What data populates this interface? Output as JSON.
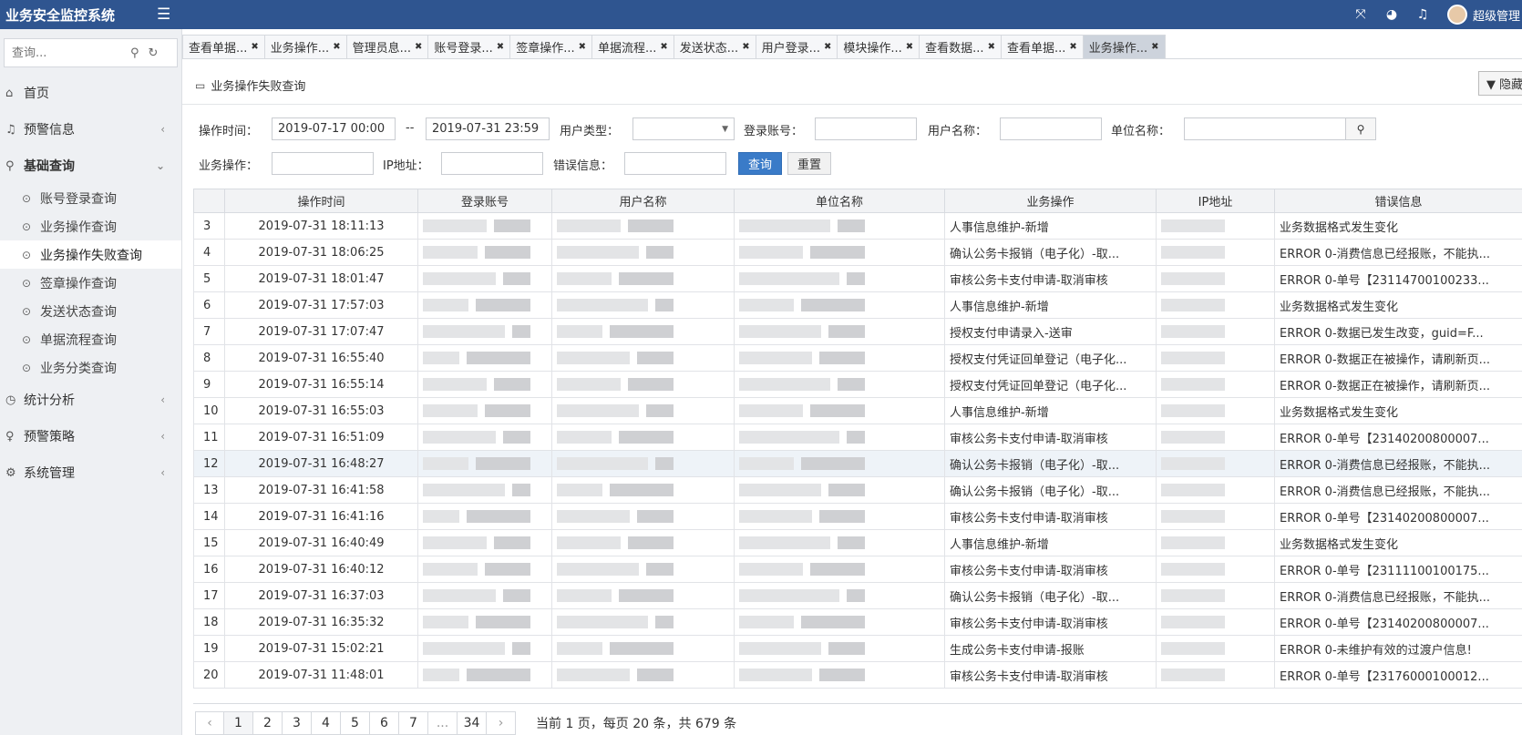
{
  "header": {
    "title": "业务安全监控系统",
    "user_name": "超级管理",
    "menu_icon": "hamburger-icon",
    "right_icons": [
      "fullscreen-icon",
      "dashboard-icon",
      "bell-icon"
    ]
  },
  "sidebar": {
    "search_placeholder": "查询...",
    "menu": [
      {
        "label": "首页",
        "icon": "home-icon"
      },
      {
        "label": "预警信息",
        "icon": "bell-icon"
      },
      {
        "label": "基础查询",
        "icon": "search-icon"
      },
      {
        "label": "统计分析",
        "icon": "clock-icon"
      },
      {
        "label": "预警策略",
        "icon": "bulb-icon"
      },
      {
        "label": "系统管理",
        "icon": "gear-icon"
      }
    ],
    "submenu": [
      "账号登录查询",
      "业务操作查询",
      "业务操作失败查询",
      "签章操作查询",
      "发送状态查询",
      "单据流程查询",
      "业务分类查询"
    ]
  },
  "tabs": [
    "查看单据...",
    "业务操作...",
    "管理员息...",
    "账号登录...",
    "签章操作...",
    "单据流程...",
    "发送状态...",
    "用户登录...",
    "模块操作...",
    "查看数据...",
    "查看单据...",
    "业务操作..."
  ],
  "page": {
    "title": "业务操作失败查询",
    "hide_label": "▼ 隐藏"
  },
  "filters": {
    "op_time_label": "操作时间：",
    "start_time": "2019-07-17 00:00",
    "range_sep": "--",
    "end_time": "2019-07-31 23:59",
    "user_type_label": "用户类型：",
    "login_account_label": "登录账号：",
    "user_name_label": "用户名称：",
    "unit_name_label": "单位名称：",
    "biz_op_label": "业务操作：",
    "ip_label": "IP地址：",
    "error_label": "错误信息：",
    "query_button": "查询",
    "reset_button": "重置"
  },
  "table": {
    "columns": [
      "",
      "操作时间",
      "登录账号",
      "用户名称",
      "单位名称",
      "业务操作",
      "IP地址",
      "错误信息"
    ],
    "rows": [
      {
        "idx": "3",
        "time": "2019-07-31 18:11:13",
        "op": "人事信息维护-新增",
        "error": "业务数据格式发生变化"
      },
      {
        "idx": "4",
        "time": "2019-07-31 18:06:25",
        "op": "确认公务卡报销（电子化）-取...",
        "error": "ERROR  0-消费信息已经报账，不能执..."
      },
      {
        "idx": "5",
        "time": "2019-07-31 18:01:47",
        "op": "审核公务卡支付申请-取消审核",
        "error": "ERROR  0-单号【23114700100233..."
      },
      {
        "idx": "6",
        "time": "2019-07-31 17:57:03",
        "op": "人事信息维护-新增",
        "error": "业务数据格式发生变化"
      },
      {
        "idx": "7",
        "time": "2019-07-31 17:07:47",
        "op": "授权支付申请录入-送审",
        "error": "ERROR  0-数据已发生改变，guid=F..."
      },
      {
        "idx": "8",
        "time": "2019-07-31 16:55:40",
        "op": "授权支付凭证回单登记（电子化...",
        "error": "ERROR  0-数据正在被操作，请刷新页..."
      },
      {
        "idx": "9",
        "time": "2019-07-31 16:55:14",
        "op": "授权支付凭证回单登记（电子化...",
        "error": "ERROR  0-数据正在被操作，请刷新页..."
      },
      {
        "idx": "10",
        "time": "2019-07-31 16:55:03",
        "op": "人事信息维护-新增",
        "error": "业务数据格式发生变化"
      },
      {
        "idx": "11",
        "time": "2019-07-31 16:51:09",
        "op": "审核公务卡支付申请-取消审核",
        "error": "ERROR  0-单号【23140200800007..."
      },
      {
        "idx": "12",
        "time": "2019-07-31 16:48:27",
        "op": "确认公务卡报销（电子化）-取...",
        "error": "ERROR  0-消费信息已经报账，不能执..."
      },
      {
        "idx": "13",
        "time": "2019-07-31 16:41:58",
        "op": "确认公务卡报销（电子化）-取...",
        "error": "ERROR  0-消费信息已经报账，不能执..."
      },
      {
        "idx": "14",
        "time": "2019-07-31 16:41:16",
        "op": "审核公务卡支付申请-取消审核",
        "error": "ERROR  0-单号【23140200800007..."
      },
      {
        "idx": "15",
        "time": "2019-07-31 16:40:49",
        "op": "人事信息维护-新增",
        "error": "业务数据格式发生变化"
      },
      {
        "idx": "16",
        "time": "2019-07-31 16:40:12",
        "op": "审核公务卡支付申请-取消审核",
        "error": "ERROR  0-单号【23111100100175..."
      },
      {
        "idx": "17",
        "time": "2019-07-31 16:37:03",
        "op": "确认公务卡报销（电子化）-取...",
        "error": "ERROR  0-消费信息已经报账，不能执..."
      },
      {
        "idx": "18",
        "time": "2019-07-31 16:35:32",
        "op": "审核公务卡支付申请-取消审核",
        "error": "ERROR  0-单号【23140200800007..."
      },
      {
        "idx": "19",
        "time": "2019-07-31 15:02:21",
        "op": "生成公务卡支付申请-报账",
        "error": "ERROR  0-未维护有效的过渡户信息!"
      },
      {
        "idx": "20",
        "time": "2019-07-31 11:48:01",
        "op": "审核公务卡支付申请-取消审核",
        "error": "ERROR  0-单号【23176000100012..."
      }
    ]
  },
  "pagination": {
    "prev": "‹",
    "pages": [
      "1",
      "2",
      "3",
      "4",
      "5",
      "6",
      "7",
      "...",
      "34"
    ],
    "next": "›",
    "info": "当前 1 页，每页 20 条，共 679 条"
  },
  "colors": {
    "header_bg": "#2f5590",
    "primary_button": "#3a7bc8",
    "sidebar_bg": "#eef0f3"
  }
}
